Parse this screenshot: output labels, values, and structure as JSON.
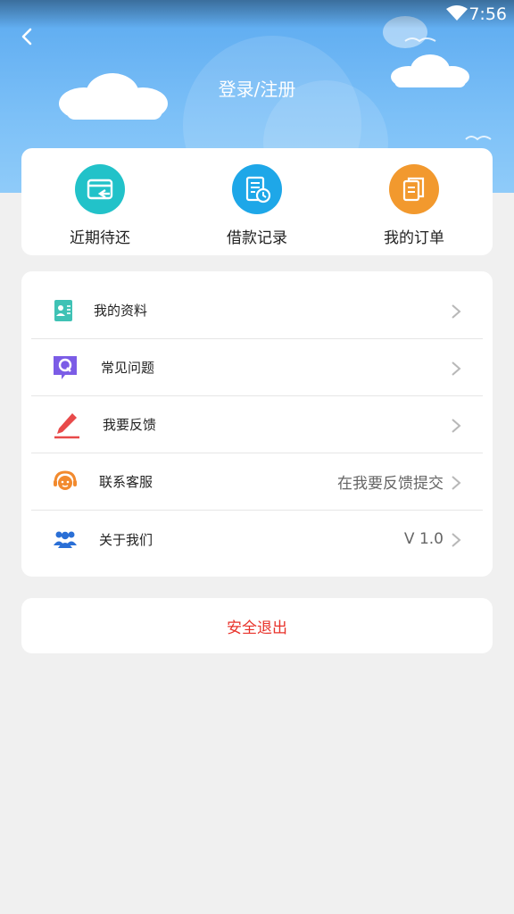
{
  "status_bar": {
    "time": "7:56"
  },
  "header": {
    "title": "登录/注册"
  },
  "quick_actions": [
    {
      "label": "近期待还",
      "icon": "card-return-icon",
      "color": "#22c2c9"
    },
    {
      "label": "借款记录",
      "icon": "document-clock-icon",
      "color": "#1ea7e8"
    },
    {
      "label": "我的订单",
      "icon": "documents-icon",
      "color": "#f2992e"
    }
  ],
  "menu": [
    {
      "label": "我的资料",
      "icon": "profile-card-icon",
      "value": ""
    },
    {
      "label": "常见问题",
      "icon": "faq-q-icon",
      "value": ""
    },
    {
      "label": "我要反馈",
      "icon": "pencil-icon",
      "value": ""
    },
    {
      "label": "联系客服",
      "icon": "headset-icon",
      "value": "在我要反馈提交"
    },
    {
      "label": "关于我们",
      "icon": "group-icon",
      "value": "V 1.0"
    }
  ],
  "logout": {
    "label": "安全退出"
  },
  "colors": {
    "header_top": "#5aa9f0",
    "header_bottom": "#8fcbf9",
    "logout_text": "#e8322a",
    "background": "#f0f0f0"
  }
}
